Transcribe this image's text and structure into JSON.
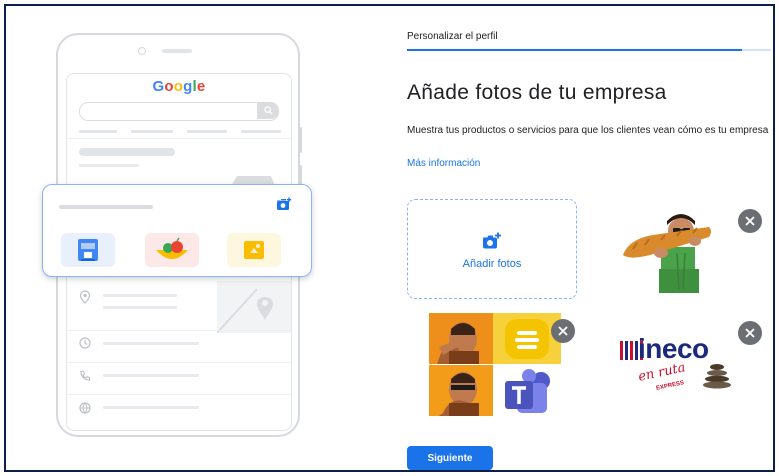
{
  "illustration": {
    "logo": {
      "letters": [
        "G",
        "o",
        "o",
        "g",
        "l",
        "e"
      ],
      "colors": [
        "#4285F4",
        "#EA4335",
        "#FBBC05",
        "#4285F4",
        "#34A853",
        "#EA4335"
      ]
    },
    "stars": "★★★★★"
  },
  "profile": {
    "step_title": "Personalizar el perfil",
    "progress_percent": 92,
    "heading": "Añade fotos de tu empresa",
    "description": "Muestra tus productos o servicios para que los clientes vean cómo es tu empresa",
    "more_info_link": "Más información",
    "add_photos_label": "Añadir fotos",
    "photos": [
      {
        "kind": "person-with-bread-photo"
      },
      {
        "kind": "meme-collage-photo"
      },
      {
        "kind": "ineco-logo",
        "text_main": "ineco",
        "text_script": "en ruta",
        "text_small": "EXPRESS"
      }
    ],
    "next_button": "Siguiente"
  },
  "colors": {
    "accent": "#1a73e8",
    "dashed_border": "#8ab4f8",
    "close": "#6b6f73",
    "frame": "#0b1f4a"
  }
}
